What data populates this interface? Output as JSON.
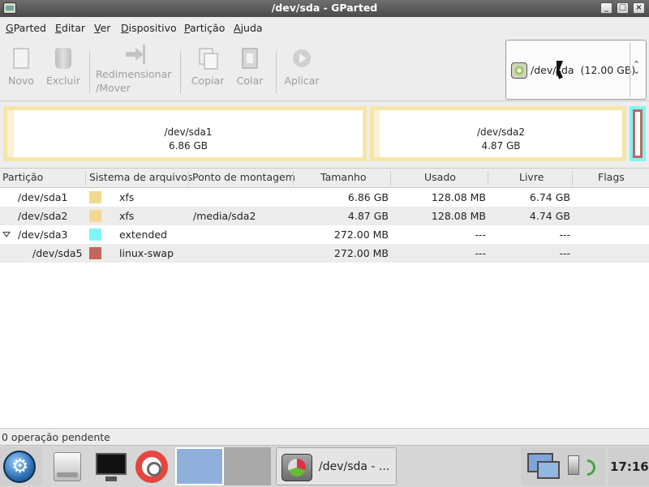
{
  "window": {
    "title": "/dev/sda - GParted",
    "controls": {
      "minimize": "_",
      "maximize": "□",
      "close": "×"
    }
  },
  "menubar": {
    "items": [
      "GParted",
      "Editar",
      "Ver",
      "Dispositivo",
      "Partição",
      "Ajuda"
    ]
  },
  "toolbar": {
    "buttons": [
      {
        "label": "Novo",
        "icon": "new-document-icon",
        "enabled": false
      },
      {
        "label": "Excluir",
        "icon": "trash-icon",
        "enabled": false
      },
      {
        "label_line1": "Redimensionar",
        "label_line2": "/Mover",
        "icon": "resize-move-icon",
        "enabled": false
      },
      {
        "label": "Copiar",
        "icon": "copy-icon",
        "enabled": false
      },
      {
        "label": "Colar",
        "icon": "paste-icon",
        "enabled": false
      },
      {
        "label": "Aplicar",
        "icon": "apply-icon",
        "enabled": false
      }
    ]
  },
  "device_selector": {
    "device": "/dev/sda",
    "size": "(12.00 GB)",
    "display": "/dev/sda  (12.00 GB)",
    "spin": "⌃⌄"
  },
  "disk_map": {
    "partitions": [
      {
        "name": "/dev/sda1",
        "size": "6.86 GB",
        "fs_color": "#f5e6a8"
      },
      {
        "name": "/dev/sda2",
        "size": "4.87 GB",
        "fs_color": "#f5e6a8"
      }
    ],
    "extended_color": "#7ff5f5",
    "swap_color": "#c3665e"
  },
  "table": {
    "headers": [
      "Partição",
      "Sistema de arquivos",
      "Ponto de montagem",
      "Tamanho",
      "Usado",
      "Livre",
      "Flags"
    ],
    "rows": [
      {
        "partition": "/dev/sda1",
        "color": "#f1da8d",
        "fs": "xfs",
        "mount": "",
        "size": "6.86 GB",
        "used": "128.08 MB",
        "free": "6.74 GB",
        "flags": ""
      },
      {
        "partition": "/dev/sda2",
        "color": "#f1da8d",
        "fs": "xfs",
        "mount": "/media/sda2",
        "size": "4.87 GB",
        "used": "128.08 MB",
        "free": "4.74 GB",
        "flags": ""
      },
      {
        "partition": "/dev/sda3",
        "color": "#7ff5f5",
        "fs": "extended",
        "mount": "",
        "size": "272.00 MB",
        "used": "---",
        "free": "---",
        "flags": "",
        "expanded": true
      },
      {
        "partition": "/dev/sda5",
        "color": "#c3665e",
        "fs": "linux-swap",
        "mount": "",
        "size": "272.00 MB",
        "used": "---",
        "free": "---",
        "flags": ""
      }
    ]
  },
  "statusbar": {
    "text": "0 operação pendente"
  },
  "taskbar": {
    "task_label": "/dev/sda - ...",
    "clock": "17:16"
  }
}
